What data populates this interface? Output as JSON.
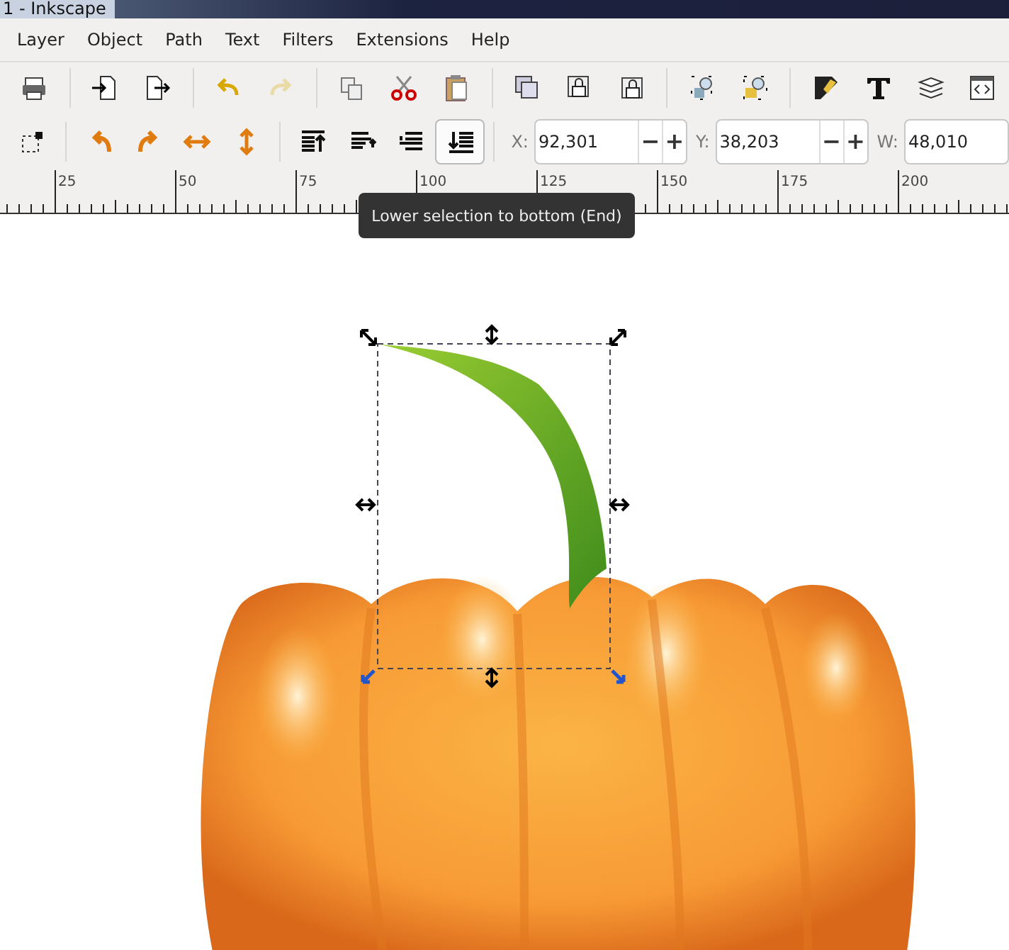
{
  "window": {
    "title": "1 - Inkscape"
  },
  "menu": [
    {
      "label": "Layer"
    },
    {
      "label": "Object"
    },
    {
      "label": "Path"
    },
    {
      "label": "Text"
    },
    {
      "label": "Filters"
    },
    {
      "label": "Extensions"
    },
    {
      "label": "Help"
    }
  ],
  "commands_bar": [
    {
      "disabled": false
    },
    {
      "disabled": false
    },
    {
      "disabled": false
    },
    {
      "disabled": false
    },
    {
      "disabled": true
    },
    {
      "disabled": false
    },
    {
      "disabled": false
    },
    {
      "disabled": false
    },
    {
      "disabled": false
    },
    {
      "disabled": false
    },
    {
      "disabled": false
    },
    {
      "disabled": false
    },
    {
      "disabled": false
    },
    {
      "disabled": false
    },
    {
      "disabled": false
    },
    {
      "disabled": false
    },
    {
      "disabled": false
    }
  ],
  "tool_controls": {
    "buttons": [
      {
        "highlighted": false
      },
      {
        "highlighted": false
      },
      {
        "highlighted": false
      },
      {
        "highlighted": false
      },
      {
        "highlighted": false
      },
      {
        "highlighted": false
      },
      {
        "highlighted": false
      },
      {
        "highlighted": false
      },
      {
        "highlighted": true
      }
    ],
    "fields": [
      {
        "label": "X:",
        "value": "92,301",
        "minus": "−",
        "plus": "+"
      },
      {
        "label": "Y:",
        "value": "38,203",
        "minus": "−",
        "plus": "+"
      },
      {
        "label": "W:",
        "value": "48,010"
      }
    ]
  },
  "ruler": {
    "labels": [
      "25",
      "50",
      "75",
      "100",
      "125",
      "150",
      "175",
      "200"
    ]
  },
  "tooltip": {
    "text": "Lower selection to bottom (End)"
  }
}
